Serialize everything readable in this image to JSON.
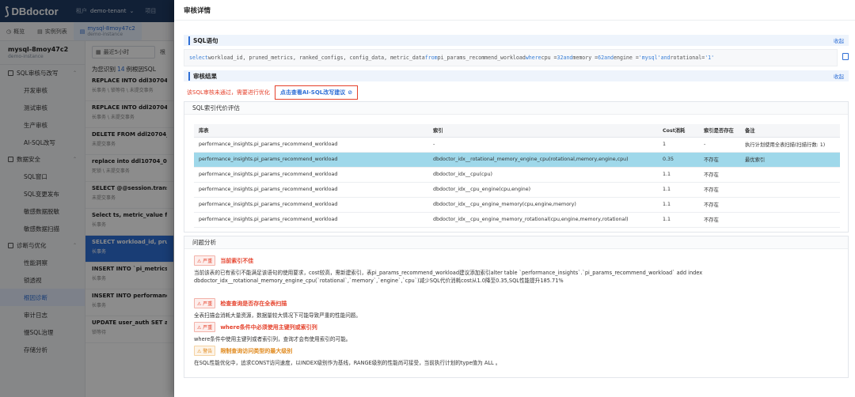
{
  "app": {
    "logo": "DBdoctor",
    "tenant_label": "租户",
    "tenant_value": "demo-tenant",
    "topbar_more": "项目"
  },
  "subheader": {
    "overview": "概览",
    "instance_list": "实例列表",
    "instance_name": "mysql-8moy47c2",
    "instance_sub": "demo-instance"
  },
  "sidebar": {
    "instance_name": "mysql-8moy47c2",
    "instance_sub": "demo-instance",
    "groups": [
      {
        "label": "SQL审核与改写",
        "items": [
          "开发审核",
          "测试审核",
          "生产审核",
          "AI-SQL改写"
        ]
      },
      {
        "label": "数据安全",
        "items": [
          "SQL窗口",
          "SQL变更发布",
          "敏感数据脱敏",
          "敏感数据扫描"
        ]
      },
      {
        "label": "诊断与优化",
        "items": [
          "性能洞察",
          "锁透视",
          "根因诊断",
          "审计日志",
          "慢SQL治理",
          "存储分析"
        ]
      }
    ],
    "active_item": "根因诊断"
  },
  "midlist": {
    "time_filter": "最近5小时",
    "extra": "根",
    "summary_prefix": "为您识别",
    "summary_count": "14",
    "summary_suffix": "例根因SQL",
    "items": [
      {
        "title": "REPLACE INTO ddl30704_0 W",
        "meta": "长事务 \\ 锁等待 \\ 未提交事务"
      },
      {
        "title": "REPLACE INTO ddl20704_0 W",
        "meta": "长事务 \\ 未提交事务"
      },
      {
        "title": "DELETE FROM ddl20704_0 W",
        "meta": "未提交事务"
      },
      {
        "title": "replace into ddl10704_0 valu",
        "meta": "死锁 \\ 未提交事务"
      },
      {
        "title": "SELECT @@session.transactio",
        "meta": "未提交事务"
      },
      {
        "title": "Select ts, metric_value from p",
        "meta": "长事务"
      },
      {
        "title": "SELECT workload_id, pruned_",
        "meta": "长事务"
      },
      {
        "title": "INSERT INTO `pi_metrics_per",
        "meta": "长事务"
      },
      {
        "title": "INSERT INTO performance_in",
        "meta": "长事务"
      },
      {
        "title": "UPDATE user_auth SET auth_",
        "meta": "锁等待"
      }
    ]
  },
  "drawer": {
    "title": "审核详情",
    "sql_section_title": "SQL语句",
    "collapse": "收起",
    "sql_parts": {
      "p1": "select",
      "p2": " workload_id, pruned_metrics, ranked_configs, config_data, metric_data  ",
      "p3": "from",
      "p4": " pi_params_recommend_workload ",
      "p5": "where",
      "p6": " cpu = ",
      "p7": "32",
      "p8": " ",
      "p9": "and",
      "p10": " memory = ",
      "p11": "62",
      "p12": " ",
      "p13": "and",
      "p14": " engine = ",
      "p15": "'mysql'",
      "p16": " ",
      "p17": "and",
      "p18": " rotational=",
      "p19": "'1'"
    },
    "result_section_title": "审核结果",
    "fail_text": "该SQL审核未通过，需要进行优化",
    "ai_link": "点击查看AI-SQL改写建议",
    "index_panel_title": "SQL索引代价评估",
    "index_table": {
      "headers": [
        "库表",
        "索引",
        "Cost消耗",
        "索引是否存在",
        "备注"
      ],
      "rows": [
        [
          "performance_insights.pi_params_recommend_workload",
          "-",
          "1",
          "-",
          "执行计划使用全表扫描(扫描行数: 1)"
        ],
        [
          "performance_insights.pi_params_recommend_workload",
          "dbdoctor_idx__rotational_memory_engine_cpu(rotational,memory,engine,cpu)",
          "0.35",
          "不存在",
          "最优索引"
        ],
        [
          "performance_insights.pi_params_recommend_workload",
          "dbdoctor_idx__cpu(cpu)",
          "1.1",
          "不存在",
          ""
        ],
        [
          "performance_insights.pi_params_recommend_workload",
          "dbdoctor_idx__cpu_engine(cpu,engine)",
          "1.1",
          "不存在",
          ""
        ],
        [
          "performance_insights.pi_params_recommend_workload",
          "dbdoctor_idx__cpu_engine_memory(cpu,engine,memory)",
          "1.1",
          "不存在",
          ""
        ],
        [
          "performance_insights.pi_params_recommend_workload",
          "dbdoctor_idx__cpu_engine_memory_rotational(cpu,engine,memory,rotational)",
          "1.1",
          "不存在",
          ""
        ]
      ],
      "highlight_row": 1
    },
    "issues_panel_title": "问题分析",
    "issues": [
      {
        "tag": "严重",
        "level": "severe",
        "title": "当前索引不佳",
        "desc_1": "当前该表的已有索引不能满足该语句的使用要求，cost较高，需新建索引，表pi_params_recommend_workload建议添加索引alter table `performance_insights`.`pi_params_recommend_workload` add index",
        "desc_2": "dbdoctor_idx__rotational_memory_engine_cpu(`rotational`,`memory`,`engine`,`cpu`)减少SQL代价消耗cost从1.0降至0.35,SQL性能提升185.71%"
      },
      {
        "tag": "严重",
        "level": "severe",
        "title": "检查查询是否存在全表扫描",
        "desc_1": "全表扫描会消耗大量资源，数据量较大情况下可能导致严重的性能问题。",
        "desc_2": ""
      },
      {
        "tag": "严重",
        "level": "severe",
        "title": "where条件中必须使用主键列或索引列",
        "desc_1": "where条件中使用主键列或者索引列，查询才会有使用索引的可能。",
        "desc_2": ""
      },
      {
        "tag": "警告",
        "level": "warn",
        "title": "限制查询访问类型的最大级别",
        "desc_1": "在SQL性能优化中，追求CONST访问速度，以INDEX级别作为基线，RANGE级别的性能尚可接受，当前执行计划的type值为 ALL 。",
        "desc_2": ""
      }
    ]
  },
  "colors": {
    "brand": "#2f6fd6",
    "danger": "#e5412b",
    "warn": "#e08a1e",
    "highlight_row": "#9fd8ea",
    "topbar": "#1f3b63"
  }
}
